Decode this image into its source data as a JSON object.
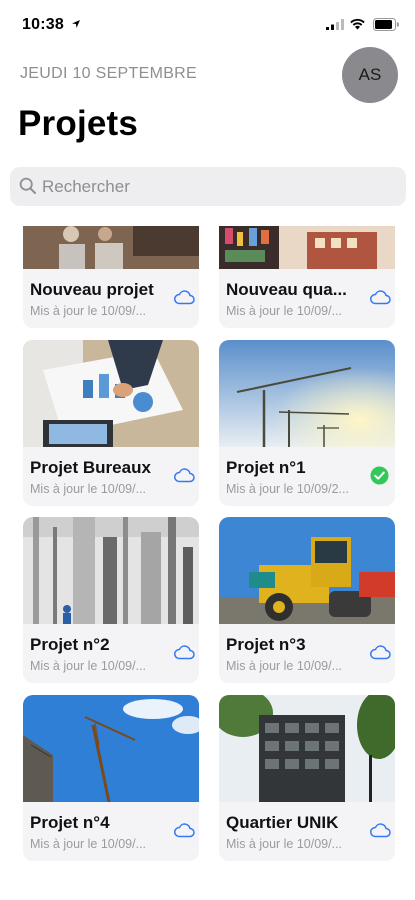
{
  "status_bar": {
    "time": "10:38"
  },
  "header": {
    "date": "JEUDI 10 SEPTEMBRE",
    "title": "Projets",
    "avatar_initials": "AS"
  },
  "search": {
    "placeholder": "Rechercher"
  },
  "colors": {
    "accent": "#3478f6",
    "success": "#34c759",
    "card_bg": "#f2f2f4",
    "secondary_text": "#8e8e93"
  },
  "projects": [
    {
      "title": "Nouveau projet",
      "subtitle": "Mis à jour le 10/09/...",
      "status_icon": "cloud-icon"
    },
    {
      "title": "Nouveau qua...",
      "subtitle": "Mis à jour le 10/09/...",
      "status_icon": "cloud-icon"
    },
    {
      "title": "Projet Bureaux",
      "subtitle": "Mis à jour le 10/09/...",
      "status_icon": "cloud-icon"
    },
    {
      "title": "Projet n°1",
      "subtitle": "Mis à jour le 10/09/2...",
      "status_icon": "checkmark-circle-icon"
    },
    {
      "title": "Projet n°2",
      "subtitle": "Mis à jour le 10/09/...",
      "status_icon": "cloud-icon"
    },
    {
      "title": "Projet n°3",
      "subtitle": "Mis à jour le 10/09/...",
      "status_icon": "cloud-icon"
    },
    {
      "title": "Projet n°4",
      "subtitle": "Mis à jour le 10/09/...",
      "status_icon": "cloud-icon"
    },
    {
      "title": "Quartier UNIK",
      "subtitle": "Mis à jour le 10/09/...",
      "status_icon": "cloud-icon"
    }
  ]
}
